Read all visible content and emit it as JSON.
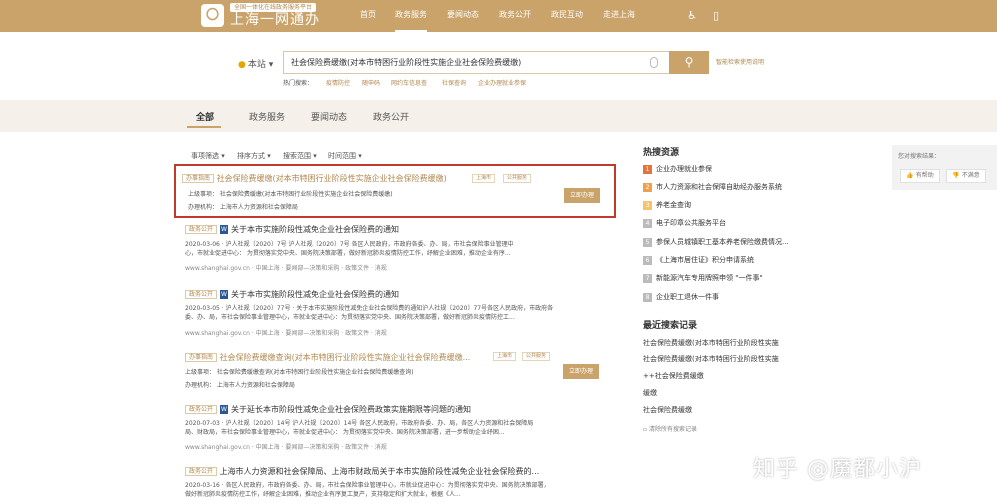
{
  "header": {
    "logo_char": "〇",
    "tagline": "全国一体化在线政务服务平台",
    "title": "上海一网通办",
    "nav": [
      "首页",
      "政务服务",
      "要闻动态",
      "政务公开",
      "政民互动",
      "走进上海"
    ],
    "active_nav": "政务服务"
  },
  "search": {
    "scope": "本站",
    "query": "社会保险费缓缴(对本市特困行业阶段性实施企业社会保险费缓缴)",
    "smart_link": "智能检索使用说明",
    "hot_label": "热门搜索：",
    "hot_terms": [
      "疫情防控",
      "随申码",
      "网约车信息查",
      "社保查询",
      "企业办理就业参保"
    ]
  },
  "tabs": [
    "全部",
    "政务服务",
    "要闻动态",
    "政务公开"
  ],
  "filters": [
    "事项筛选 ▾",
    "排序方式 ▾",
    "搜索范围 ▾",
    "时间范围 ▾"
  ],
  "results": {
    "r1": {
      "badge": "办事指南",
      "title": "社会保险费缓缴(对本市特困行业阶段性实施企业社会保险费缓缴)",
      "tag1": "上海市",
      "tag2": "公共服务",
      "line1": "上级事项：   社会保险费缓缴(对本市特困行业阶段性实施企业社会保险费缓缴)",
      "line2": "办理机构：   上海市人力资源和社会保障局",
      "apply": "立即办理"
    },
    "r2": {
      "badge": "政务公开",
      "title": "关于本市实施阶段性减免企业社会保险费的通知",
      "meta": "2020-03-06 · 沪人社规〔2020〕7号     沪人社规〔2020〕7号     各区人民政府，市政府各委、办、局，市社会保险事业管理中",
      "desc1": "心，市就业促进中心：      为贯彻落实党中央、国务院决策部署，做好新冠肺炎疫情防控工作，纾解企业困难，推动企业有序...",
      "url": "www.shanghai.gov.cn · 中国上海 · 要闻部—决策和采购 · 政策文件 · 消规"
    },
    "r3": {
      "badge": "政务公开",
      "title": "关于本市实施阶段性减免企业社会保险费的通知",
      "meta": "2020-03-05 · 沪人社规〔2020〕77号 · 关于本市实施阶段性减免企业社会保险费的通知沪人社规〔2020〕77号各区人民政府，市政府各",
      "desc1": "委、办、局，市社会保险事业管理中心，市就业促进中心：为贯彻落实党中央、国务院决策部署，做好新冠肺炎疫情防控工...",
      "url": "www.shanghai.gov.cn · 中国上海 · 要闻部—决策和采购 · 政策文件 · 消规"
    },
    "r4": {
      "badge": "办事指南",
      "title_gold": "社会保险费缓缴查询",
      "title_tail": "(对本市特困行业阶段性实施企业社会保险费缓缴...",
      "tag1": "上海市",
      "tag2": "公共服务",
      "line1": "上级事项：   社会保险费缓缴查询(对本市特困行业阶段性实施企业社会保险费缓缴查询)",
      "line2": "办理机构：   上海市人力资源和社会保障局",
      "apply": "立即办理"
    },
    "r5": {
      "badge": "政务公开",
      "title": "关于延长本市阶段性减免企业社会保险费政策实施期限等问题的通知",
      "meta": "2020-07-03 · 沪人社规〔2020〕14号     沪人社规〔2020〕14号     各区人民政府，市政府各委、办、局，各区人力资源和社会保障局",
      "desc1": "局、财政局，市社会保险事业管理中心，市就业促进中心：      为贯彻落实党中央、国务院决策部署，进一步帮助企业纾困...",
      "url": "www.shanghai.gov.cn · 中国上海 · 要闻部—决策和采购 · 政策文件 · 消规"
    },
    "r6": {
      "badge": "政务公开",
      "title": "上海市人力资源和社会保障局、上海市财政局关于本市实施阶段性减免企业社会保险费的...",
      "meta": "2020-03-16 · 各区人民政府，市政府各委、办、局，市社会保险事业管理中心，市就业促进中心：为贯彻落实党中央、国务院决策部署，",
      "desc1": "做好新冠肺炎疫情防控工作，纾解企业困难，推动企业有序复工复产，支持稳定和扩大就业，根据《人..."
    }
  },
  "sidebar": {
    "hot_title": "热搜资源",
    "hot_items": [
      "企业办理就业参保",
      "市人力资源和社会保障自助经办服务系统",
      "养老金查询",
      "电子印章公共服务平台",
      "参保人员城镇职工基本养老保险缴费情况...",
      "《上海市居住证》积分申请系统",
      "新能源汽车专用牌照申领 \"一件事\"",
      "企业职工退休一件事"
    ],
    "recent_title": "最近搜索记录",
    "recent_items": [
      "社会保险费缓缴(对本市特困行业阶段性实施",
      "社会保险费缓缴(对本市特困行业阶段性实施",
      "++社会保险费缓缴",
      "缓缴",
      "社会保险费缓缴"
    ],
    "clear": "清除所有搜索记录"
  },
  "feedback": {
    "title": "您对搜索结果：",
    "useful": "有帮助",
    "useless": "不满意"
  },
  "watermark": "知乎 @魔都小沪"
}
